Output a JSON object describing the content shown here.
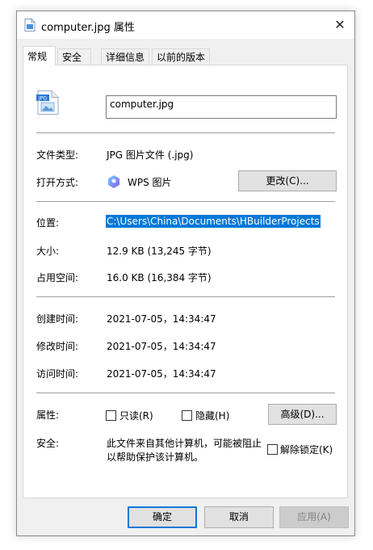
{
  "window": {
    "title": "computer.jpg 属性",
    "close_glyph": "✕"
  },
  "tabs": [
    {
      "label": "常规",
      "active": true
    },
    {
      "label": "安全",
      "active": false
    },
    {
      "label": "详细信息",
      "active": false
    },
    {
      "label": "以前的版本",
      "active": false
    }
  ],
  "file": {
    "icon_label": "JPG",
    "name": "computer.jpg"
  },
  "props": {
    "type_label": "文件类型:",
    "type_value": "JPG 图片文件 (.jpg)",
    "open_label": "打开方式:",
    "open_value": "WPS 图片",
    "change_button": "更改(C)...",
    "location_label": "位置:",
    "location_value": "C:\\Users\\China\\Documents\\HBuilderProjects",
    "size_label": "大小:",
    "size_value": "12.9 KB (13,245 字节)",
    "disk_label": "占用空间:",
    "disk_value": "16.0 KB (16,384 字节)",
    "created_label": "创建时间:",
    "created_value": "2021-07-05，14:34:47",
    "modified_label": "修改时间:",
    "modified_value": "2021-07-05，14:34:47",
    "accessed_label": "访问时间:",
    "accessed_value": "2021-07-05，14:34:47",
    "attributes_label": "属性:",
    "readonly_label": "只读(R)",
    "hidden_label": "隐藏(H)",
    "advanced_button": "高级(D)...",
    "security_label": "安全:",
    "security_text_line1": "此文件来自其他计算机，可能被阻止",
    "security_text_line2": "以帮助保护该计算机。",
    "unblock_label": "解除锁定(K)"
  },
  "footer": {
    "ok": "确定",
    "cancel": "取消",
    "apply": "应用(A)"
  },
  "colors": {
    "accent": "#0078d7",
    "selection": "#0078d7"
  }
}
